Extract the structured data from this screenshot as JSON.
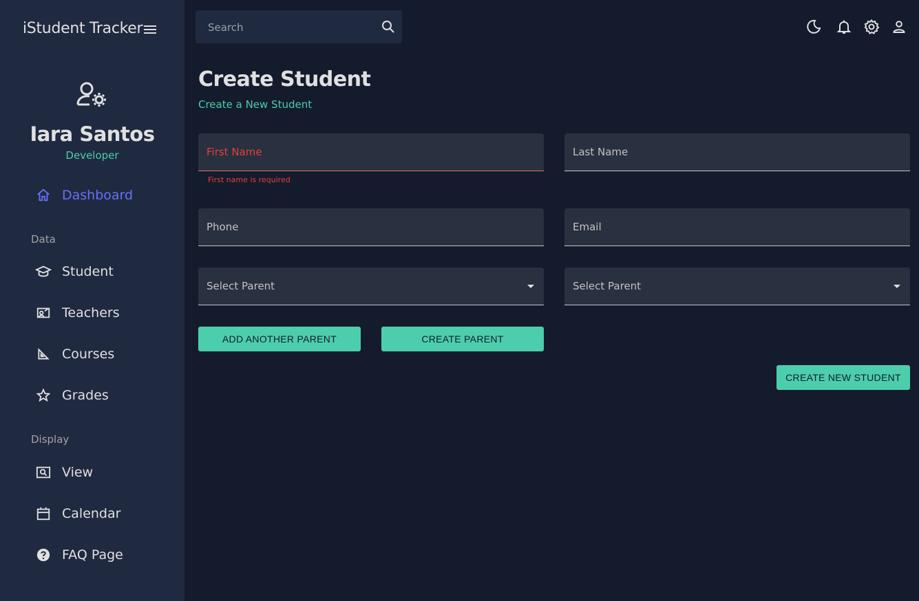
{
  "app": {
    "title": "iStudent Tracker"
  },
  "colors": {
    "accent": "#4cceac",
    "active_nav": "#6870fa",
    "error": "#e2413a",
    "bg": "#141b2d",
    "sidebar_bg": "#1f2a40"
  },
  "user": {
    "name": "Iara Santos",
    "role": "Developer"
  },
  "sidebar": {
    "dashboard": "Dashboard",
    "section_data": "Data",
    "student": "Student",
    "teachers": "Teachers",
    "courses": "Courses",
    "grades": "Grades",
    "section_display": "Display",
    "view": "View",
    "calendar": "Calendar",
    "faq": "FAQ Page"
  },
  "topbar": {
    "search_placeholder": "Search",
    "icons": [
      "moon-icon",
      "bell-icon",
      "gear-icon",
      "person-icon"
    ]
  },
  "page": {
    "title": "Create Student",
    "subtitle": "Create a New Student"
  },
  "form": {
    "first_name": "First Name",
    "first_name_error": "First name is required",
    "last_name": "Last Name",
    "phone": "Phone",
    "email": "Email",
    "parent1": "Select Parent",
    "parent2": "Select Parent"
  },
  "buttons": {
    "add_parent": "ADD ANOTHER PARENT",
    "create_parent": "CREATE PARENT",
    "create_student": "CREATE NEW STUDENT"
  }
}
